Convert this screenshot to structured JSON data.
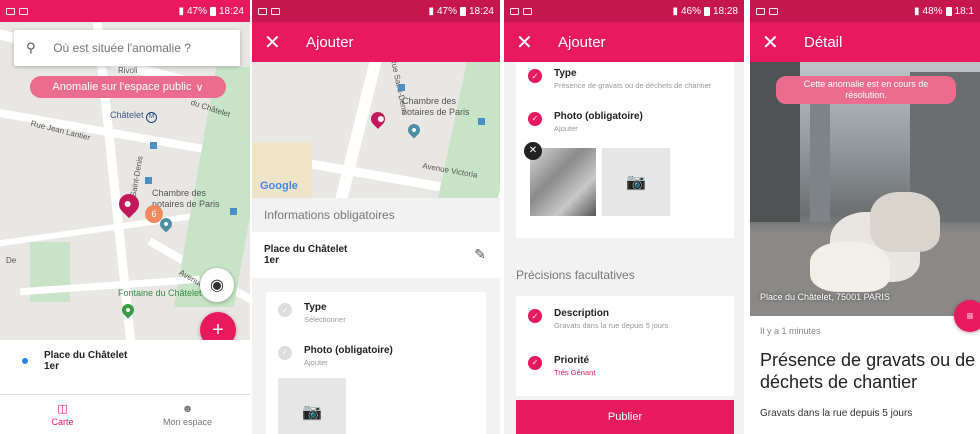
{
  "colors": {
    "accent": "#e8195e",
    "chip": "#ec6c8d",
    "map_bg": "#e9e7e3",
    "park": "#c7e5c6"
  },
  "screen1": {
    "status": {
      "battery": "47%",
      "time": "18:24"
    },
    "search_placeholder": "Où est située l'anomalie ?",
    "chip_label": "Anomalie sur l'espace public",
    "chip_icon": "chevron-down-icon",
    "map_labels": [
      "Châtelet",
      "Chambre des notaires de Paris",
      "Rue Jean Lantier",
      "Fontaine du Châtelet",
      "Saint-Denis",
      "De",
      "Avenue",
      "Rivoli",
      "du Châtelet"
    ],
    "location": {
      "name": "Place du Châtelet",
      "district": "1er"
    },
    "tabs": [
      {
        "label": "Carte",
        "icon": "map-icon"
      },
      {
        "label": "Mon espace",
        "icon": "person-icon"
      }
    ]
  },
  "screen2": {
    "status": {
      "battery": "47%",
      "time": "18:24"
    },
    "title": "Ajouter",
    "map_labels": [
      "Chambre des notaires de Paris",
      "Google",
      "Avenue Victoria",
      "Rue Saint-Denis"
    ],
    "section_required": "Informations obligatoires",
    "location": {
      "name": "Place du Châtelet",
      "district": "1er"
    },
    "items": [
      {
        "title": "Type",
        "sub": "Sélectionner"
      },
      {
        "title": "Photo (obligatoire)",
        "sub": "Ajouter"
      }
    ]
  },
  "screen3": {
    "status": {
      "battery": "46%",
      "time": "18:28"
    },
    "title": "Ajouter",
    "items_required": [
      {
        "title": "Type",
        "sub": "Présence de gravats ou de déchets de chantier"
      },
      {
        "title": "Photo (obligatoire)",
        "sub": "Ajouter"
      }
    ],
    "section_optional": "Précisions facultatives",
    "items_optional": [
      {
        "title": "Description",
        "sub": "Gravats dans la rue depuis 5 jours"
      },
      {
        "title": "Priorité",
        "sub": "Très Gênant"
      }
    ],
    "publish_label": "Publier"
  },
  "screen4": {
    "status": {
      "battery": "48%",
      "time": "18:1"
    },
    "title": "Détail",
    "status_chip": "Cette anomalie est en cours de résolution.",
    "address": "Place du Châtelet, 75001 PARIS",
    "time_ago": "Il y a 1 minutes",
    "heading": "Présence de gravats ou de déchets de chantier",
    "description": "Gravats dans la rue depuis 5 jours"
  }
}
